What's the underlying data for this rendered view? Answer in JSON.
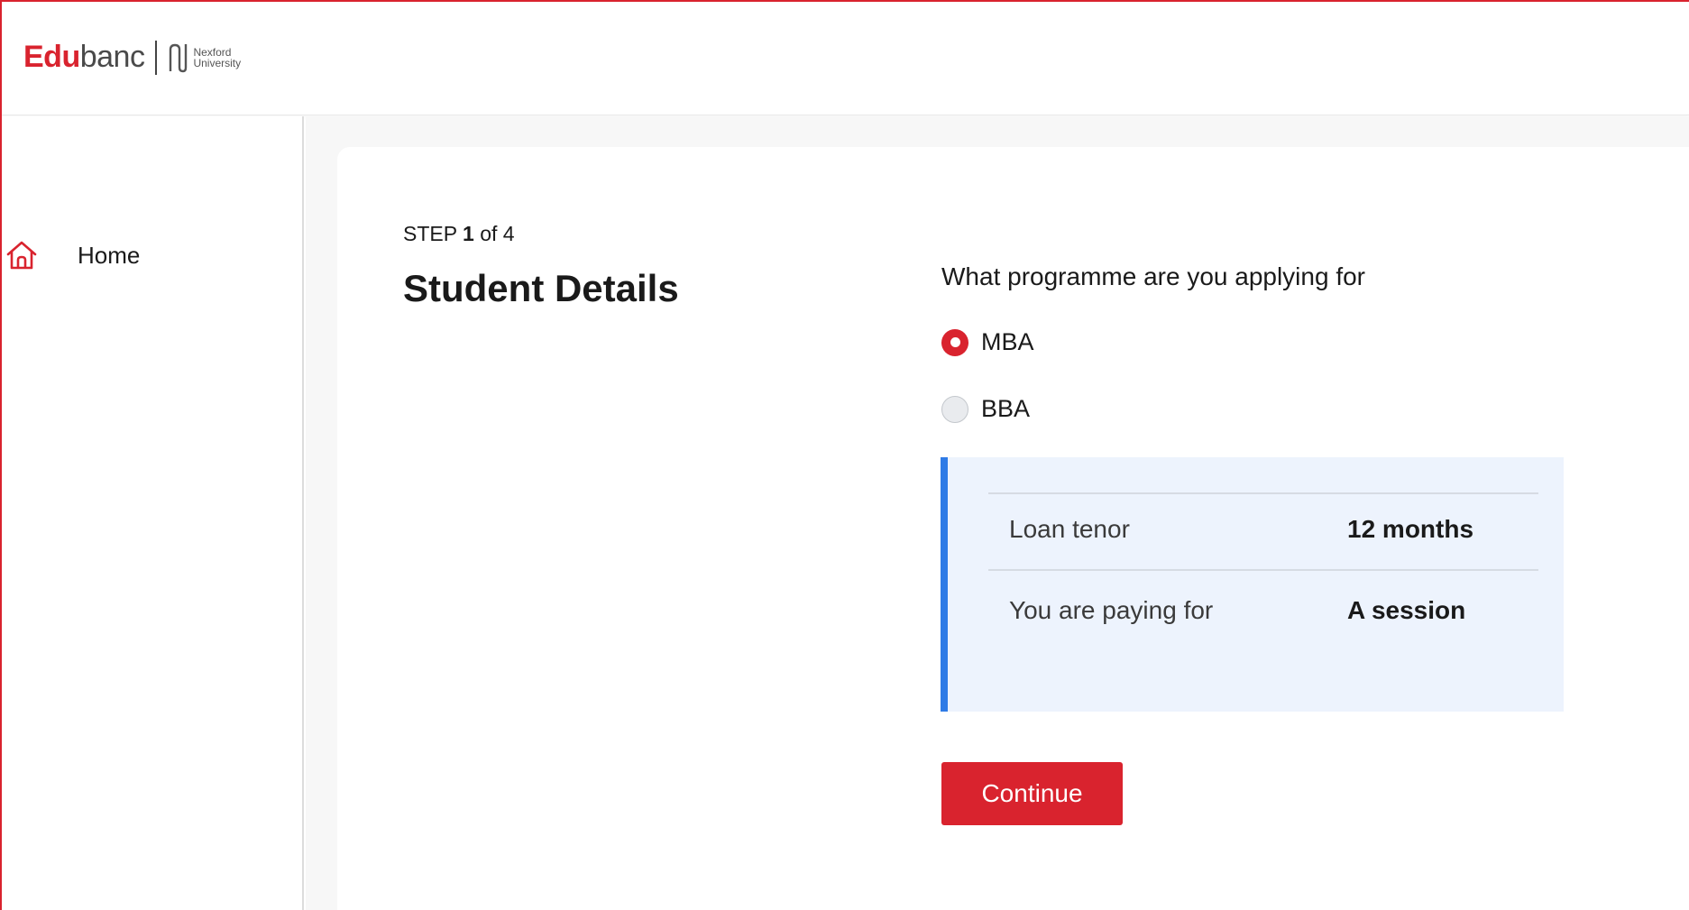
{
  "brand": {
    "name_part1": "Edu",
    "name_part2": "banc",
    "partner_line1": "Nexford",
    "partner_line2": "University",
    "accent_color": "#d9232e"
  },
  "sidebar": {
    "items": [
      {
        "label": "Home",
        "icon": "home-icon"
      }
    ]
  },
  "form": {
    "step_prefix": "STEP",
    "step_current": "1",
    "step_suffix": "of 4",
    "title": "Student Details",
    "question": "What programme are you applying for",
    "options": [
      {
        "label": "MBA",
        "selected": true
      },
      {
        "label": "BBA",
        "selected": false
      }
    ],
    "info": {
      "rows": [
        {
          "key": "Loan tenor",
          "value": "12 months"
        },
        {
          "key": "You are paying for",
          "value": "A session"
        }
      ],
      "accent_color": "#2f7be6"
    },
    "continue_label": "Continue"
  }
}
